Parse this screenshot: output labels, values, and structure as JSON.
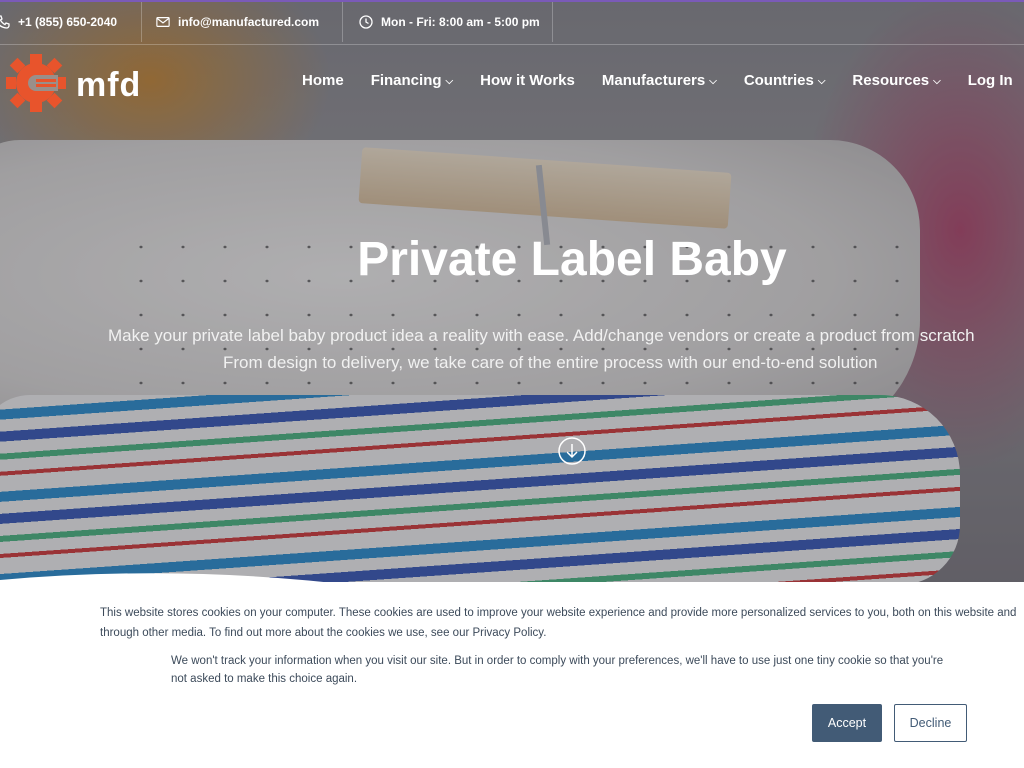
{
  "topbar": {
    "phone": "+1 (855) 650-2040",
    "email": "info@manufactured.com",
    "hours": "Mon - Fri: 8:00 am - 5:00 pm"
  },
  "logo": {
    "text": "mfd",
    "color": "#e8542c"
  },
  "nav": {
    "items": [
      {
        "label": "Home",
        "dropdown": false
      },
      {
        "label": "Financing",
        "dropdown": true
      },
      {
        "label": "How it Works",
        "dropdown": false
      },
      {
        "label": "Manufacturers",
        "dropdown": true
      },
      {
        "label": "Countries",
        "dropdown": true
      },
      {
        "label": "Resources",
        "dropdown": true
      },
      {
        "label": "Log In",
        "dropdown": false
      }
    ]
  },
  "hero": {
    "title": "Private Label Baby",
    "subtitle_line1": "Make your private label baby product idea a reality with ease. Add/change vendors or create a product from scratch",
    "subtitle_line2": "From design to delivery, we take care of the entire process with our end-to-end solution"
  },
  "cookie": {
    "line1": "This website stores cookies on your computer. These cookies are used to improve your website experience and provide more personalized services to you, both on this website and",
    "line2": "through other media. To find out more about the cookies we use, see our Privacy Policy.",
    "line3": "We won't track your information when you visit our site. But in order to comply with your preferences, we'll have to use just one tiny cookie so that you're",
    "line4": "not asked to make this choice again.",
    "accept_label": "Accept",
    "decline_label": "Decline",
    "accent_color": "#425b76"
  }
}
